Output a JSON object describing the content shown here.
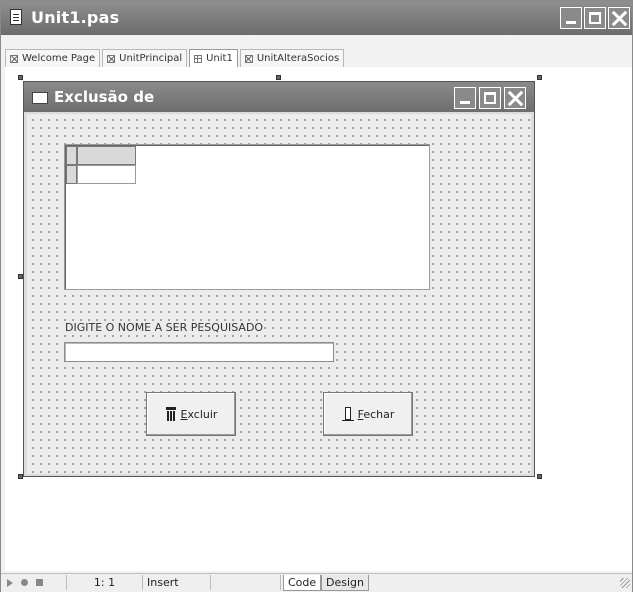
{
  "ide": {
    "title": "Unit1.pas",
    "tabs": [
      {
        "label": "Welcome Page",
        "icon": "close-x-icon"
      },
      {
        "label": "UnitPrincipal",
        "icon": "close-x-icon"
      },
      {
        "label": "Unit1",
        "icon": "form-grid-icon",
        "active": true
      },
      {
        "label": "UnitAlteraSocios",
        "icon": "close-x-icon"
      }
    ]
  },
  "form": {
    "title": "Exclusão de",
    "search_label": "DIGITE O NOME A SER PESQUISADO",
    "search_value": "",
    "excluir_first_letter": "E",
    "excluir_rest": "xcluir",
    "fechar_first_letter": "F",
    "fechar_rest": "echar"
  },
  "statusbar": {
    "position": "1:  1",
    "mode": "Insert",
    "tab_code": "Code",
    "tab_design": "Design"
  },
  "colors": {
    "titlebar": "#7d7d7d",
    "form_bg": "#ececec"
  }
}
